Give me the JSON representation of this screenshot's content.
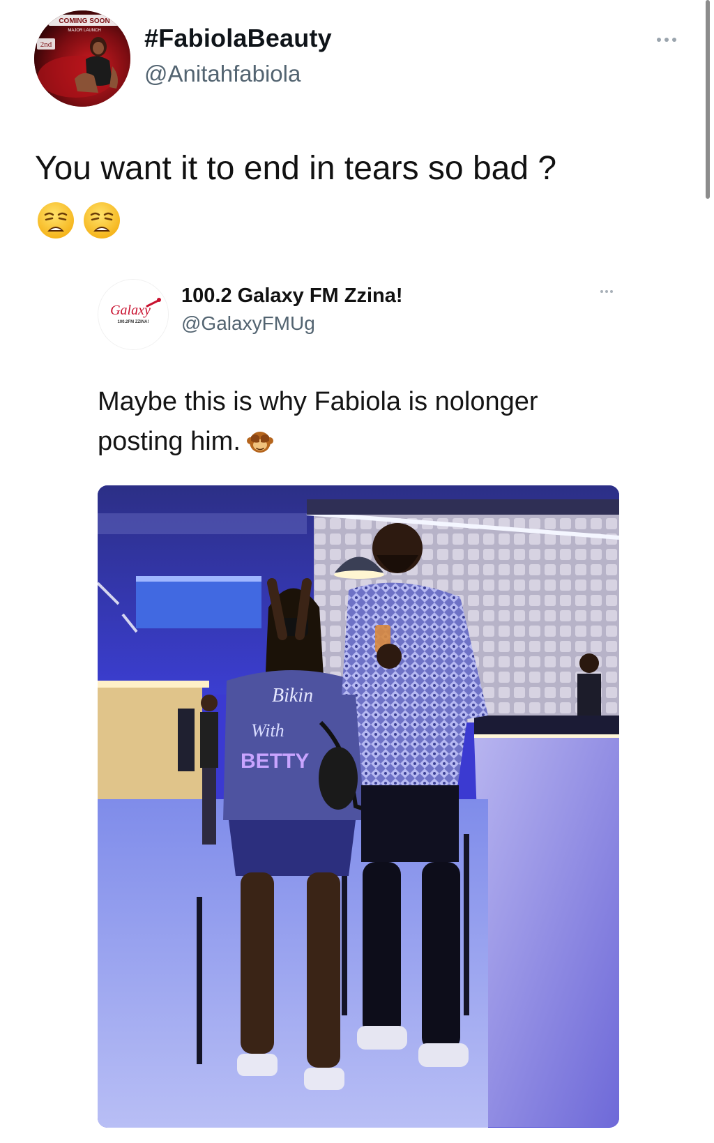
{
  "tweet": {
    "author_name": "#FabiolaBeauty",
    "author_handle": "@Anitahfabiola",
    "text": "You want it to end in tears so bad ?",
    "emojis": [
      "weary-face",
      "weary-face"
    ],
    "avatar": {
      "badge_top": "COMING SOON",
      "badge_sub": "MAJOR LAUNCH",
      "badge_side": "2nd"
    }
  },
  "quoted_tweet": {
    "author_name": "100.2 Galaxy FM Zzina!",
    "author_handle": "@GalaxyFMUg",
    "text": "Maybe this is why Fabiola is nolonger posting him.",
    "emoji": "see-no-evil-monkey",
    "avatar_logo": "Galaxy",
    "avatar_logo_sub": "100.2FM ZZINA!",
    "photo": {
      "shirt_text_1": "Bikin",
      "shirt_text_2": "With",
      "shirt_text_3": "BETTY"
    }
  },
  "icons": {
    "more": "more-horizontal-icon"
  },
  "colors": {
    "text": "#0f1419",
    "secondary": "#536471",
    "photo_tint": "#3b3ad1"
  }
}
